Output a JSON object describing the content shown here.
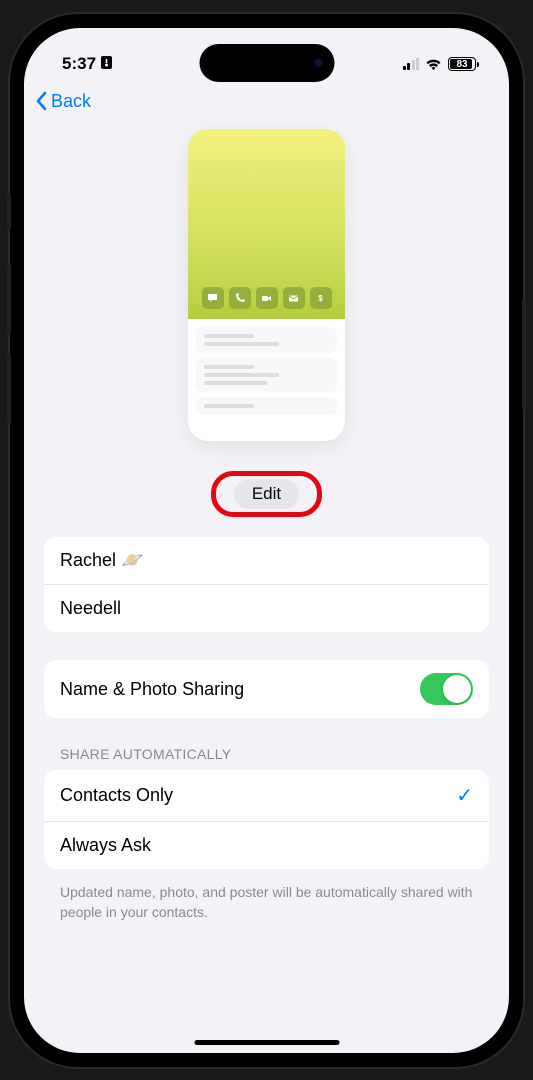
{
  "statusBar": {
    "time": "5:37",
    "battery": "83"
  },
  "nav": {
    "back": "Back"
  },
  "edit": {
    "label": "Edit"
  },
  "name": {
    "first": "Rachel 🪐",
    "last": "Needell"
  },
  "sharing": {
    "label": "Name & Photo Sharing",
    "enabled": true
  },
  "shareAuto": {
    "header": "SHARE AUTOMATICALLY",
    "options": [
      {
        "label": "Contacts Only",
        "selected": true
      },
      {
        "label": "Always Ask",
        "selected": false
      }
    ],
    "footer": "Updated name, photo, and poster will be automatically shared with people in your contacts."
  }
}
